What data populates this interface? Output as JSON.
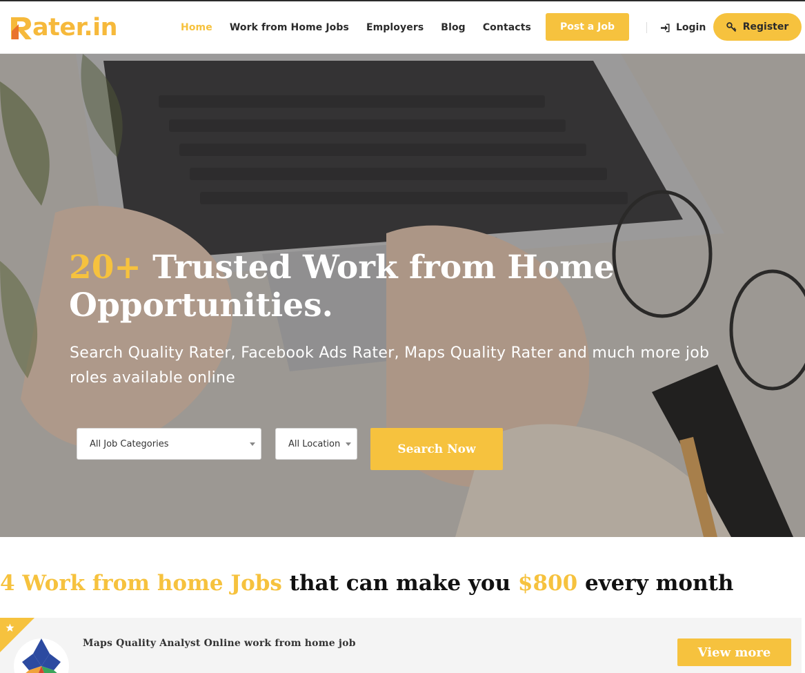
{
  "header": {
    "logo_text": "ater.in",
    "nav": [
      {
        "label": "Home",
        "active": true
      },
      {
        "label": "Work from Home Jobs",
        "active": false
      },
      {
        "label": "Employers",
        "active": false
      },
      {
        "label": "Blog",
        "active": false
      },
      {
        "label": "Contacts",
        "active": false
      }
    ],
    "post_job_label": "Post a Job",
    "login_label": "Login",
    "register_label": "Register"
  },
  "hero": {
    "title_accent": "20+",
    "title_rest": " Trusted Work from Home Opportunities.",
    "subtitle": "Search Quality Rater, Facebook Ads Rater, Maps Quality Rater and much more job roles available online",
    "category_select": {
      "selected": "All Job Categories"
    },
    "location_select": {
      "selected": "All Location"
    },
    "search_button": "Search Now"
  },
  "section": {
    "title_part1": "4 Work from home Jobs",
    "title_part2": " that can make you ",
    "title_part3": "$800",
    "title_part4": " every month"
  },
  "jobs": [
    {
      "title": "Maps Quality Analyst Online work from home job",
      "button": "View more",
      "featured": true
    }
  ],
  "colors": {
    "accent": "#f6c23e",
    "text_dark": "#2b2b2b",
    "card_bg": "#f4f4f4"
  },
  "icons": {
    "login": "sign-in-icon",
    "register": "key-icon",
    "featured": "star-icon"
  }
}
